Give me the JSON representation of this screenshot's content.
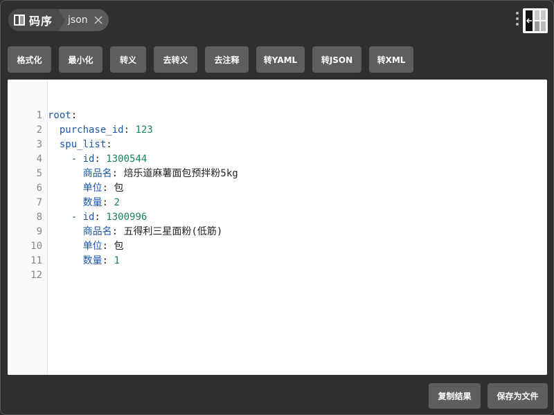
{
  "app": {
    "name": "码序",
    "tab_label": "json"
  },
  "icons": {
    "logo": "book-icon",
    "close": "close-icon",
    "menu": "vertical-dots-icon",
    "sidebar": "sidebar-toggle-icon"
  },
  "toolbar": [
    {
      "id": "format",
      "label": "格式化"
    },
    {
      "id": "minify",
      "label": "最小化"
    },
    {
      "id": "escape",
      "label": "转义"
    },
    {
      "id": "unescape",
      "label": "去转义"
    },
    {
      "id": "strip-comments",
      "label": "去注释"
    },
    {
      "id": "to-yaml",
      "label": "转YAML"
    },
    {
      "id": "to-json",
      "label": "转JSON"
    },
    {
      "id": "to-xml",
      "label": "转XML"
    }
  ],
  "editor": {
    "lines": [
      {
        "no": "",
        "indent": "",
        "dash": "",
        "key": "root",
        "sep": ":",
        "value": "",
        "vtype": ""
      },
      {
        "no": "1",
        "indent": "  ",
        "dash": "",
        "key": "purchase_id",
        "sep": ": ",
        "value": "123",
        "vtype": "num"
      },
      {
        "no": "2",
        "indent": "  ",
        "dash": "",
        "key": "spu_list",
        "sep": ":",
        "value": "",
        "vtype": ""
      },
      {
        "no": "3",
        "indent": "    ",
        "dash": "- ",
        "key": "id",
        "sep": ": ",
        "value": "1300544",
        "vtype": "num"
      },
      {
        "no": "4",
        "indent": "      ",
        "dash": "",
        "key": "商品名",
        "sep": ": ",
        "value": "焙乐道麻薯面包预拌粉5kg",
        "vtype": "str"
      },
      {
        "no": "5",
        "indent": "      ",
        "dash": "",
        "key": "单位",
        "sep": ": ",
        "value": "包",
        "vtype": "str"
      },
      {
        "no": "6",
        "indent": "      ",
        "dash": "",
        "key": "数量",
        "sep": ": ",
        "value": "2",
        "vtype": "num"
      },
      {
        "no": "7",
        "indent": "    ",
        "dash": "- ",
        "key": "id",
        "sep": ": ",
        "value": "1300996",
        "vtype": "num"
      },
      {
        "no": "8",
        "indent": "      ",
        "dash": "",
        "key": "商品名",
        "sep": ": ",
        "value": "五得利三星面粉(低筋)",
        "vtype": "str"
      },
      {
        "no": "9",
        "indent": "      ",
        "dash": "",
        "key": "单位",
        "sep": ": ",
        "value": "包",
        "vtype": "str"
      },
      {
        "no": "10",
        "indent": "      ",
        "dash": "",
        "key": "数量",
        "sep": ": ",
        "value": "1",
        "vtype": "num"
      },
      {
        "no": "11",
        "indent": "",
        "dash": "",
        "key": "",
        "sep": "",
        "value": "",
        "vtype": ""
      },
      {
        "no": "12",
        "indent": "",
        "dash": "",
        "key": "",
        "sep": "",
        "value": "",
        "vtype": ""
      }
    ]
  },
  "footer": {
    "copy_label": "复制结果",
    "save_label": "保存为文件"
  }
}
